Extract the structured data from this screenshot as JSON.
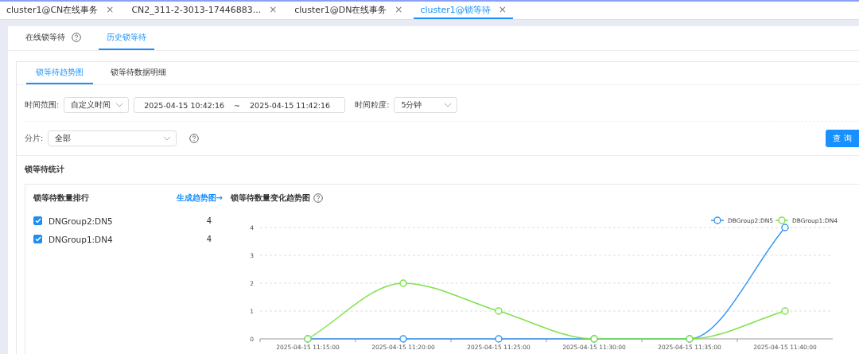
{
  "tabs": [
    {
      "label": "cluster1@CN在线事务",
      "selected": false
    },
    {
      "label": "CN2_311-2-3013-17446883...",
      "selected": false
    },
    {
      "label": "cluster1@DN在线事务",
      "selected": false
    },
    {
      "label": "cluster1@锁等待",
      "selected": true
    }
  ],
  "close_icon_text": "×",
  "mode_tabs": [
    {
      "label": "在线锁等待",
      "help": true,
      "selected": false
    },
    {
      "label": "历史锁等待",
      "help": false,
      "selected": true
    }
  ],
  "view_tabs": [
    {
      "label": "锁等待趋势图",
      "selected": true
    },
    {
      "label": "锁等待数据明细",
      "selected": false
    }
  ],
  "filters": {
    "time_range_label": "时间范围:",
    "time_range_value": "自定义时间",
    "start": "2025-04-15 10:42:16",
    "separator": "~",
    "end": "2025-04-15 11:42:16",
    "granularity_label": "时间粒度:",
    "granularity_value": "5分钟",
    "shard_label": "分片:",
    "shard_value": "全部",
    "query_button": "查 询"
  },
  "section_title": "锁等待统计",
  "ranking": {
    "title": "锁等待数量排行",
    "link": "生成趋势图→",
    "rows": [
      {
        "name": "DNGroup2:DN5",
        "count": "4",
        "checked": true
      },
      {
        "name": "DNGroup1:DN4",
        "count": "4",
        "checked": true
      }
    ]
  },
  "trend": {
    "title": "锁等待数量变化趋势图",
    "chart_data": {
      "type": "line",
      "categories": [
        "2025-04-15 11:15:00",
        "2025-04-15 11:20:00",
        "2025-04-15 11:25:00",
        "2025-04-15 11:30:00",
        "2025-04-15 11:35:00",
        "2025-04-15 11:40:00"
      ],
      "ylim": [
        0,
        4
      ],
      "grid": true,
      "legend": true,
      "yticks": [
        0,
        1,
        2,
        3,
        4
      ],
      "series": [
        {
          "name": "DBGroup2:DN5",
          "color": "#3a97f5",
          "marker": "circle",
          "values": [
            0,
            0,
            0,
            0,
            0,
            4
          ]
        },
        {
          "name": "DBGroup1:DN4",
          "color": "#7ee24a",
          "marker": "circle",
          "values": [
            0,
            2,
            1,
            0,
            0,
            1
          ]
        }
      ]
    }
  }
}
